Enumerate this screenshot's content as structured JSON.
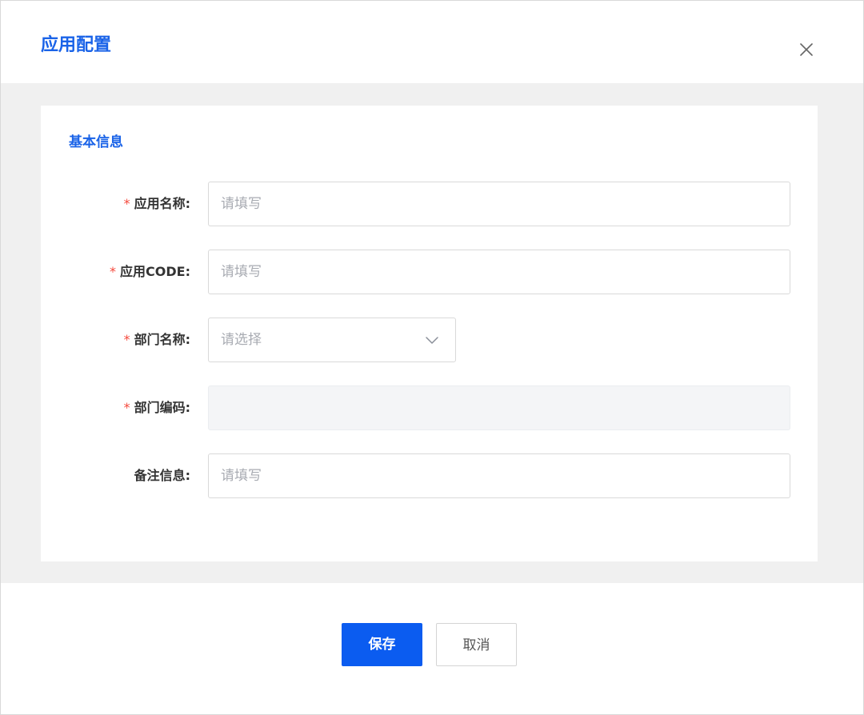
{
  "dialog": {
    "title": "应用配置",
    "close_icon": "close-icon"
  },
  "section": {
    "title": "基本信息"
  },
  "form": {
    "required_mark": "*",
    "app_name": {
      "label": "应用名称:",
      "required": true,
      "placeholder": "请填写",
      "value": ""
    },
    "app_code": {
      "label": "应用CODE:",
      "required": true,
      "placeholder": "请填写",
      "value": ""
    },
    "dept_name": {
      "label": "部门名称:",
      "required": true,
      "placeholder": "请选择",
      "value": "",
      "icon": "chevron-down-icon"
    },
    "dept_code": {
      "label": "部门编码:",
      "required": true,
      "disabled": true,
      "value": ""
    },
    "remark": {
      "label": "备注信息:",
      "required": false,
      "placeholder": "请填写",
      "value": ""
    }
  },
  "footer": {
    "save_label": "保存",
    "cancel_label": "取消"
  },
  "colors": {
    "accent": "#1a63e8",
    "primary_button": "#0b5cf0",
    "required": "#f5483b",
    "placeholder": "#a8abb2",
    "body_bg": "#f0f0f0",
    "disabled_bg": "#f4f5f7"
  }
}
